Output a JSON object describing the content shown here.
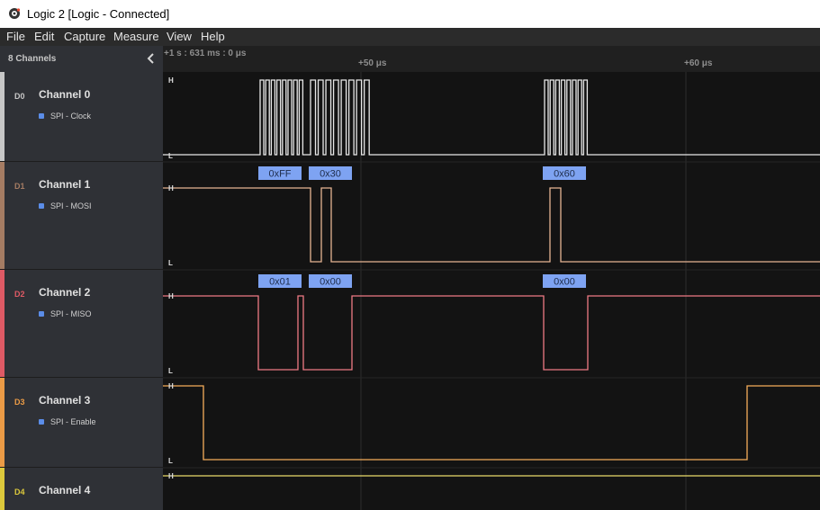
{
  "window": {
    "title": "Logic 2 [Logic - Connected]"
  },
  "menu": {
    "items": [
      "File",
      "Edit",
      "Capture",
      "Measure",
      "View",
      "Help"
    ]
  },
  "sidebar": {
    "channel_count": "8 Channels"
  },
  "timeline": {
    "start": "+1 s : 631 ms : 0 μs",
    "marker_1": "+50 μs",
    "marker_2": "+60 μs"
  },
  "channels": [
    {
      "digital": "D0",
      "name": "Channel 0",
      "analyzer": "SPI - Clock",
      "color": "#c7c7c7",
      "wave_color": "#e8e8e8"
    },
    {
      "digital": "D1",
      "name": "Channel 1",
      "analyzer": "SPI - MOSI",
      "color": "#a57c63",
      "wave_color": "#e6b493"
    },
    {
      "digital": "D2",
      "name": "Channel 2",
      "analyzer": "SPI - MISO",
      "color": "#df5a65",
      "wave_color": "#ee7a84"
    },
    {
      "digital": "D3",
      "name": "Channel 3",
      "analyzer": "SPI - Enable",
      "color": "#eb9b46",
      "wave_color": "#f5ad5a"
    },
    {
      "digital": "D4",
      "name": "Channel 4",
      "color": "#dcc93c",
      "wave_color": "#eadc6a"
    }
  ],
  "levels": {
    "high": "H",
    "low": "L"
  },
  "decoded": {
    "mosi": [
      "0xFF",
      "0x30",
      "0x60"
    ],
    "miso": [
      "0x01",
      "0x00",
      "0x00"
    ]
  },
  "colors": {
    "badge": "#7ea3f2",
    "grid": "#2c2c2c",
    "analyzer_dot": "#5b8de8"
  }
}
